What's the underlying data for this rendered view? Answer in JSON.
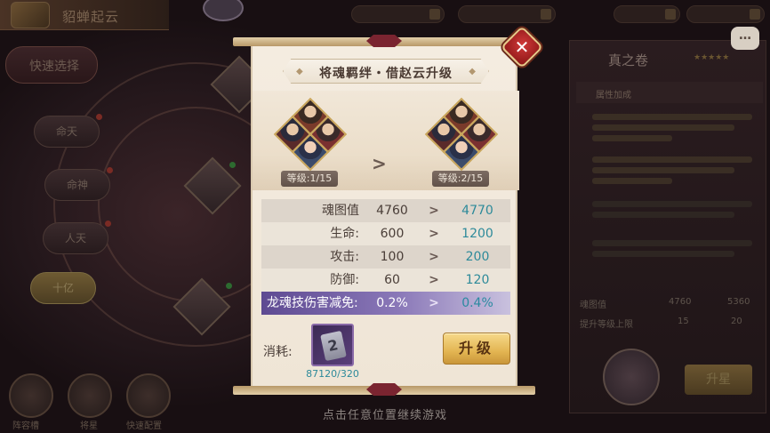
{
  "background": {
    "panel_title": "貂蝉起云",
    "quick_select": "快速选择",
    "tabs": [
      "命天",
      "命神",
      "人天",
      "十亿"
    ],
    "bottom_labels": [
      "阵容槽",
      "将星",
      "快速配置"
    ],
    "right_title": "真之卷",
    "right_header": "属性加成",
    "right_stat_1_label": "魂图值",
    "right_stat_1_old": "4760",
    "right_stat_1_new": "5360",
    "right_stat_2_label": "提升等级上限",
    "right_stat_2_old": "15",
    "right_stat_2_new": "20",
    "right_button": "升星",
    "chat_icon": "chat-bubble-icon"
  },
  "dialog": {
    "title": "将魂羁绊・借赵云升级",
    "current_level": "等级:1/15",
    "next_level": "等级:2/15",
    "stats": [
      {
        "label": "魂图值",
        "old": "4760",
        "new": "4770"
      },
      {
        "label": "生命:",
        "old": "600",
        "new": "1200"
      },
      {
        "label": "攻击:",
        "old": "100",
        "new": "200"
      },
      {
        "label": "防御:",
        "old": "60",
        "new": "120"
      },
      {
        "label": "龙魂技伤害减免:",
        "old": "0.2%",
        "new": "0.4%"
      }
    ],
    "arrow": ">",
    "cost_label": "消耗:",
    "cost_count": "87120/320",
    "upgrade_button": "升级"
  },
  "hint": "点击任意位置继续游戏",
  "colors": {
    "new_value": "#2d8a9a",
    "button_gold": "#e3b552",
    "special_row": "#5e4a92",
    "close_red": "#d03a3a"
  }
}
